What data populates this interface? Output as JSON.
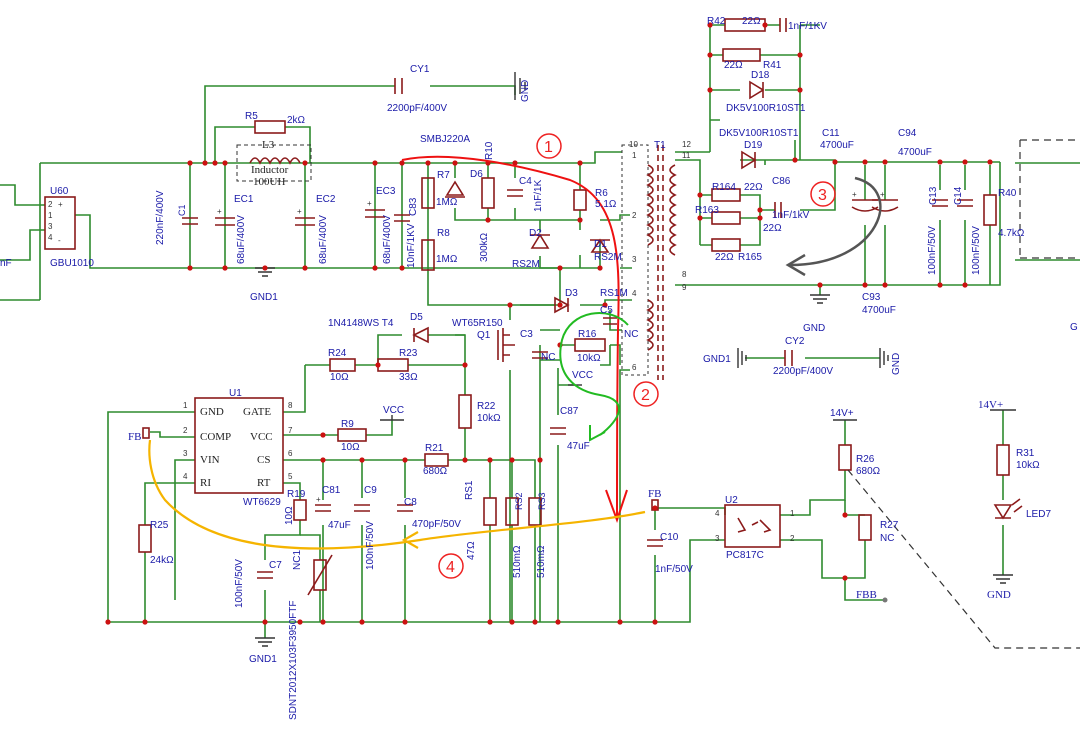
{
  "labels": {
    "u60": "U60",
    "gbu": "GBU1010",
    "cy1": "CY1",
    "cy1v": "2200pF/400V",
    "r5": "R5",
    "r5v": "2kΩ",
    "inductor": "Inductor",
    "l3": "L3",
    "l3v": "100UH",
    "smbj": "SMBJ220A",
    "r10": "R10",
    "c1": "C1",
    "c1v": "220nF/400V",
    "ec1": "EC1",
    "ec1v": "68uF/400V",
    "ec2": "EC2",
    "ec2v": "68uF/400V",
    "ec3": "EC3",
    "ec3v": "68uF/400V",
    "c83": "C83",
    "c83v": "10nF/1KV",
    "r7": "R7",
    "r7v": "1MΩ",
    "r8": "R8",
    "r8v": "1MΩ",
    "d6": "D6",
    "d6v": "300kΩ",
    "c4": "C4",
    "c4v": "1nF/1K",
    "r6": "R6",
    "r6v": "5.1Ω",
    "d2": "D2",
    "d2v": "RS2M",
    "d1": "D1",
    "d1v": "RS2M",
    "d3": "D3",
    "d3v": "RS1M",
    "c5": "C5",
    "c5v": "NC",
    "c3": "C3",
    "c3v": "NC",
    "r16": "R16",
    "r16v": "10kΩ",
    "vcc1": "VCC",
    "vcc2": "VCC",
    "c87": "C87",
    "c87v": "47uF",
    "d5": "D5",
    "d5v": "1N4148WS T4",
    "q1part": "WT65R150",
    "q1": "Q1",
    "r24": "R24",
    "r24v": "10Ω",
    "r23": "R23",
    "r23v": "33Ω",
    "r22": "R22",
    "r22v": "10kΩ",
    "r9": "R9",
    "r9v": "10Ω",
    "r21": "R21",
    "r21v": "680Ω",
    "rs1": "RS1",
    "rs1v": "47Ω",
    "rs2": "RS2",
    "rs2v": "510mΩ",
    "rs3": "RS3",
    "rs3v": "510mΩ",
    "u1": "U1",
    "u1part": "WT6629",
    "u1pins": {
      "gnd": "GND",
      "gate": "GATE",
      "comp": "COMP",
      "vcc": "VCC",
      "vin": "VIN",
      "cs": "CS",
      "ri": "RI",
      "rt": "RT"
    },
    "fb1": "FB",
    "fb2": "FB",
    "r19": "R19",
    "r19v": "10Ω",
    "c81": "C81",
    "c81v": "47uF",
    "c9": "C9",
    "c9v": "100nF/50V",
    "c8": "C8",
    "c8v": "470pF/50V",
    "r25": "R25",
    "r25v": "24kΩ",
    "c7": "C7",
    "c7v": "100nF/50V",
    "nc1": "NC1",
    "nc1part": "SDNT2012X103F3950FTF",
    "gnd1a": "GND1",
    "gnd1b": "GND1",
    "gnd1c": "GND1",
    "gnd": "GND",
    "gnd2": "GND",
    "gnd3": "GND",
    "gnd4": "GND",
    "t1": "T1",
    "r42": "R42",
    "r42v": "22Ω",
    "r41": "R41",
    "r41v": "22Ω",
    "c_top": "1nF/1KV",
    "d18": "D18",
    "d18v": "DK5V100R10ST1",
    "d19": "D19",
    "d19v": "DK5V100R10ST1",
    "r164": "R164",
    "r164v": "22Ω",
    "r163": "R163",
    "r163v": "22Ω",
    "r165": "R165",
    "r165v": "22Ω",
    "c86": "C86",
    "c86v": "1nF/1kV",
    "c11": "C11",
    "c11v": "4700uF",
    "c94": "C94",
    "c94v": "4700uF",
    "c93": "C93",
    "c93v": "4700uF",
    "c13": "C13",
    "c13v": "100nF/50V",
    "c14": "C14",
    "c14v": "100nF/50V",
    "r40": "R40",
    "r40v": "4.7kΩ",
    "cy2": "CY2",
    "cy2v": "2200pF/400V",
    "u2": "U2",
    "u2part": "PC817C",
    "c10": "C10",
    "c10v": "1nF/50V",
    "v14a": "14V+",
    "v14b": "14V+",
    "r26": "R26",
    "r26v": "680Ω",
    "r27": "R27",
    "r27v": "NC",
    "fbb": "FBB",
    "r31": "R31",
    "r31v": "10kΩ",
    "led7": "LED7",
    "mark1": "1",
    "mark2": "2",
    "mark3": "3",
    "mark4": "4",
    "nf": "nF",
    "g7": "G"
  },
  "colors": {
    "wire": "#2e8b2e",
    "part": "#8b1a1a",
    "label": "#1a1aa8",
    "junction": "#cc1111",
    "arrow_red": "#ee1111",
    "arrow_green": "#22bb22",
    "arrow_gray": "#555555",
    "arrow_yellow": "#f5b400"
  }
}
